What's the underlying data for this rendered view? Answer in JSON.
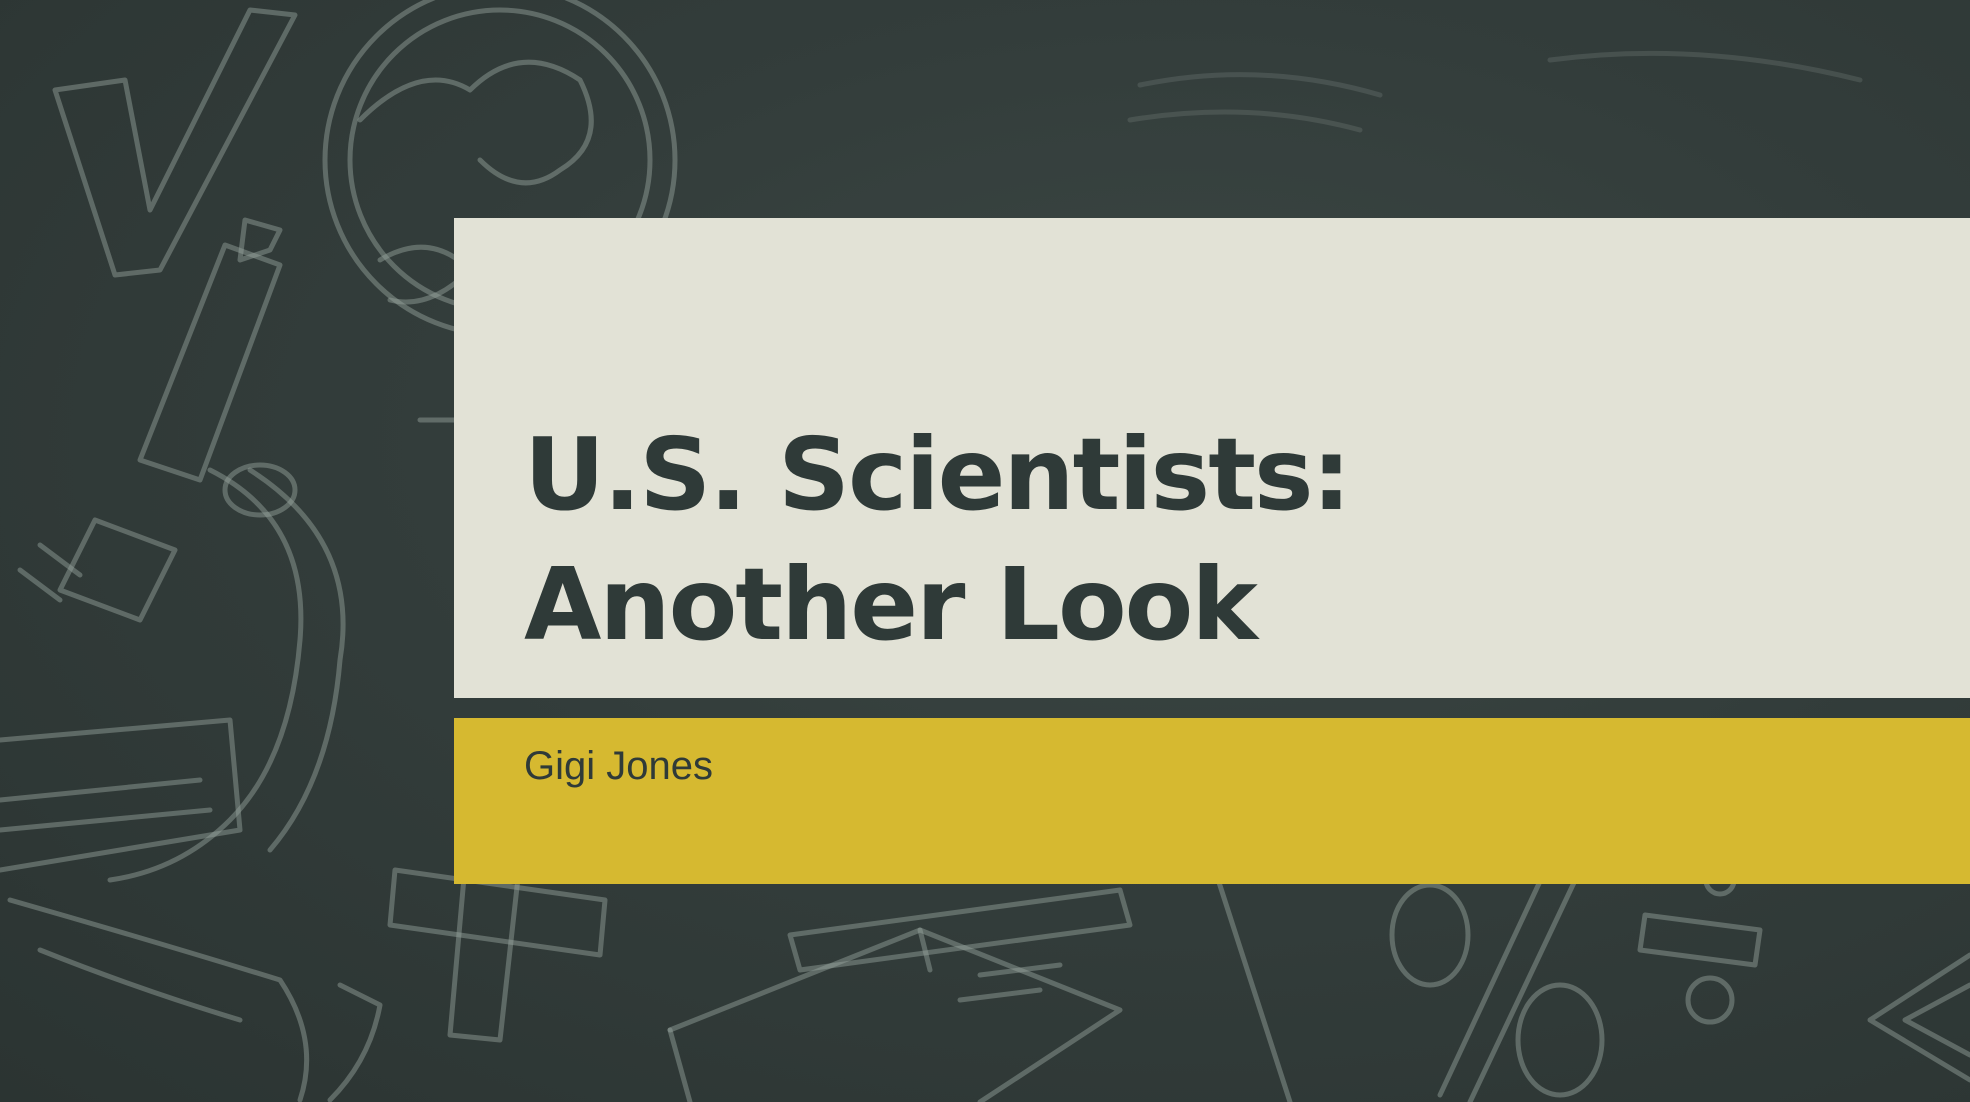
{
  "slide": {
    "title_line_1": "U.S. Scientists:",
    "title_line_2": "Another Look",
    "subtitle": "Gigi Jones"
  },
  "colors": {
    "background": "#2f3a38",
    "title_panel": "#e2e2d6",
    "subtitle_panel": "#d6b930",
    "text": "#2f3a38",
    "chalk": "#9aa69f"
  },
  "background_icons": [
    "checkmark-icon",
    "globe-icon",
    "microscope-icon",
    "plus-icon",
    "book-icon",
    "percent-icon",
    "minus-icon",
    "less-than-icon"
  ]
}
